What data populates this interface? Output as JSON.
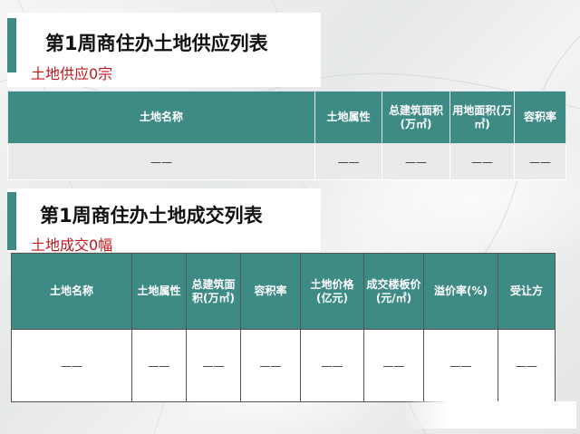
{
  "section1": {
    "title": "第1周商住办土地供应列表",
    "subtitle": "土地供应0宗",
    "headers": [
      "土地名称",
      "土地属性",
      "总建筑面积(万㎡)",
      "用地面积(万㎡)",
      "容积率"
    ],
    "row": [
      "——",
      "——",
      "——",
      "——",
      "——"
    ]
  },
  "section2": {
    "title": "第1周商住办土地成交列表",
    "subtitle": "土地成交0幅",
    "headers": [
      "土地名称",
      "土地属性",
      "总建筑面积(万㎡)",
      "容积率",
      "土地价格(亿元)",
      "成交楼板价(元/㎡)",
      "溢价率(%)",
      "受让方"
    ],
    "row": [
      "——",
      "——",
      "——",
      "——",
      "——",
      "——",
      "——",
      "——"
    ]
  },
  "colors": {
    "accent": "#3e8b86",
    "subtitle_red": "#c0161c"
  }
}
